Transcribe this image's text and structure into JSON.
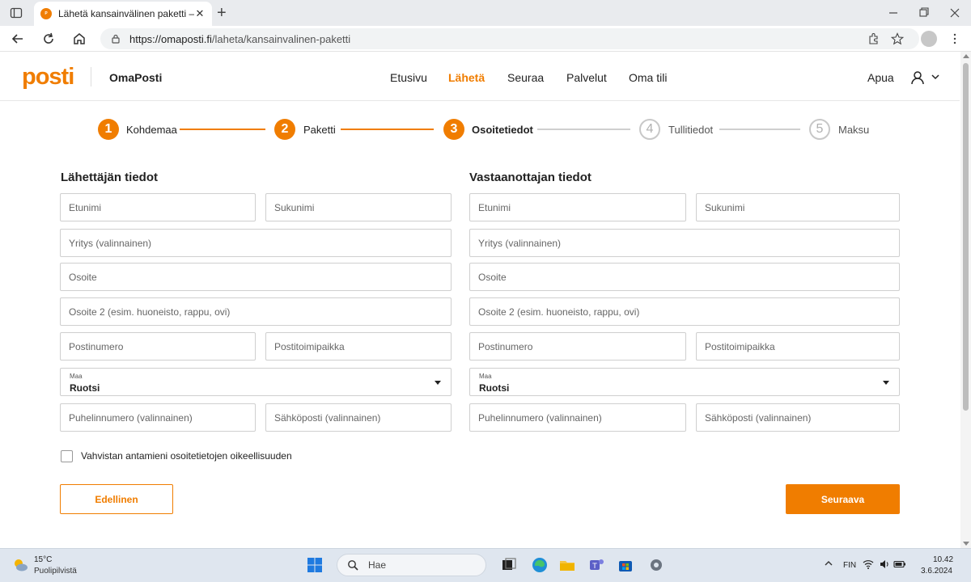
{
  "browser": {
    "tab_title": "Lähetä kansainvälinen paketti – OmaPosti",
    "url_domain": "https://omaposti.fi",
    "url_path": "/laheta/kansainvalinen-paketti",
    "new_tab_symbol": "+",
    "close_symbol": "✕"
  },
  "header": {
    "logo": "posti",
    "brand": "OmaPosti",
    "nav": [
      {
        "label": "Etusivu",
        "active": false
      },
      {
        "label": "Lähetä",
        "active": true
      },
      {
        "label": "Seuraa",
        "active": false
      },
      {
        "label": "Palvelut",
        "active": false
      },
      {
        "label": "Oma tili",
        "active": false
      }
    ],
    "help": "Apua"
  },
  "stepper": [
    {
      "num": "1",
      "label": "Kohdemaa",
      "state": "done"
    },
    {
      "num": "2",
      "label": "Paketti",
      "state": "done"
    },
    {
      "num": "3",
      "label": "Osoitetiedot",
      "state": "current"
    },
    {
      "num": "4",
      "label": "Tullitiedot",
      "state": "todo"
    },
    {
      "num": "5",
      "label": "Maksu",
      "state": "todo"
    }
  ],
  "sender": {
    "title": "Lähettäjän tiedot",
    "first_name": "Etunimi",
    "last_name": "Sukunimi",
    "company": "Yritys (valinnainen)",
    "address": "Osoite",
    "address2": "Osoite 2 (esim. huoneisto, rappu, ovi)",
    "postal_code": "Postinumero",
    "city": "Postitoimipaikka",
    "country_label": "Maa",
    "country_value": "Ruotsi",
    "phone": "Puhelinnumero (valinnainen)",
    "email": "Sähköposti (valinnainen)"
  },
  "recipient": {
    "title": "Vastaanottajan tiedot",
    "first_name": "Etunimi",
    "last_name": "Sukunimi",
    "company": "Yritys (valinnainen)",
    "address": "Osoite",
    "address2": "Osoite 2 (esim. huoneisto, rappu, ovi)",
    "postal_code": "Postinumero",
    "city": "Postitoimipaikka",
    "country_label": "Maa",
    "country_value": "Ruotsi",
    "phone": "Puhelinnumero (valinnainen)",
    "email": "Sähköposti (valinnainen)"
  },
  "confirm_label": "Vahvistan antamieni osoitetietojen oikeellisuuden",
  "buttons": {
    "previous": "Edellinen",
    "next": "Seuraava"
  },
  "taskbar": {
    "temperature": "15°C",
    "weather": "Puolipilvistä",
    "search": "Hae",
    "language": "FIN",
    "time": "10.42",
    "date": "3.6.2024"
  },
  "colors": {
    "accent": "#f07d00",
    "border": "#cfcfcf",
    "text": "#222222"
  }
}
